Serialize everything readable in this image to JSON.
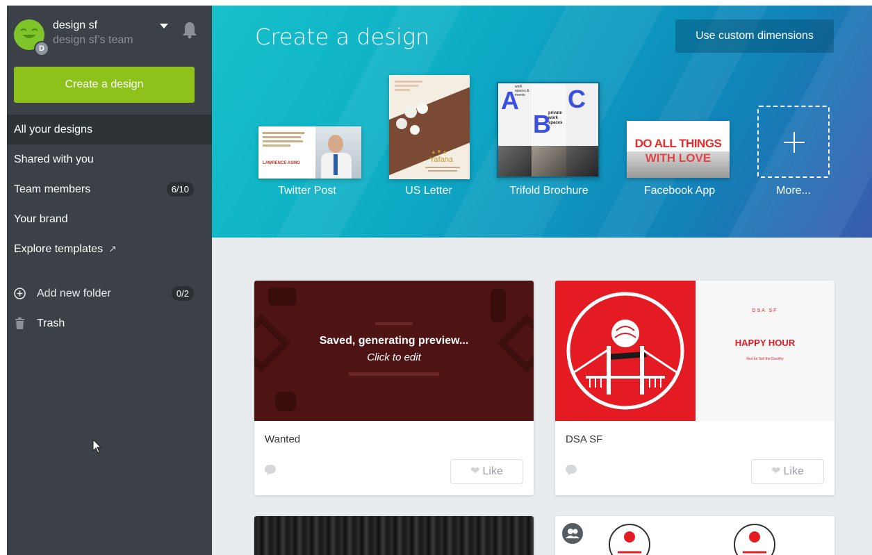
{
  "account": {
    "name": "design sf",
    "team": "design sf’s team",
    "badge_letter": "D"
  },
  "sidebar": {
    "create_label": "Create a design",
    "items": [
      {
        "label": "All your designs",
        "active": true
      },
      {
        "label": "Shared with you"
      },
      {
        "label": "Team members",
        "badge": "6/10"
      },
      {
        "label": "Your brand"
      },
      {
        "label": "Explore templates",
        "icon": "external-link-icon"
      }
    ],
    "add_folder_label": "Add new folder",
    "add_folder_badge": "0/2",
    "trash_label": "Trash"
  },
  "banner": {
    "title": "Create a design",
    "custom_dimensions_label": "Use custom dimensions",
    "templates": [
      {
        "label": "Twitter Post"
      },
      {
        "label": "US Letter"
      },
      {
        "label": "Trifold Brochure"
      },
      {
        "label": "Facebook App"
      },
      {
        "label": "More..."
      }
    ],
    "thumb_text": {
      "twitter_name": "LAWRENCE ASMO",
      "letter_brand": "Yafana",
      "brochure_letters": [
        "A",
        "B",
        "C"
      ],
      "brochure_text_1": "private work spaces",
      "brochure_text_2": "work spaces & events",
      "facebook_line_1": "DO ALL THINGS",
      "facebook_line_2": "WITH LOVE"
    }
  },
  "designs": [
    {
      "title": "Wanted",
      "overlay_title": "Saved, generating preview...",
      "overlay_sub": "Click to edit",
      "like_label": "Like"
    },
    {
      "title": "DSA SF",
      "preview_small": "DSA SF",
      "preview_heading": "HAPPY HOUR",
      "preview_sub": "Red for Sell the Dorothy",
      "like_label": "Like"
    }
  ],
  "colors": {
    "sidebar": "#3b4147",
    "accent_green": "#8cc21a",
    "wanted_bg": "#4e1414",
    "dsa_red": "#e41b23"
  }
}
